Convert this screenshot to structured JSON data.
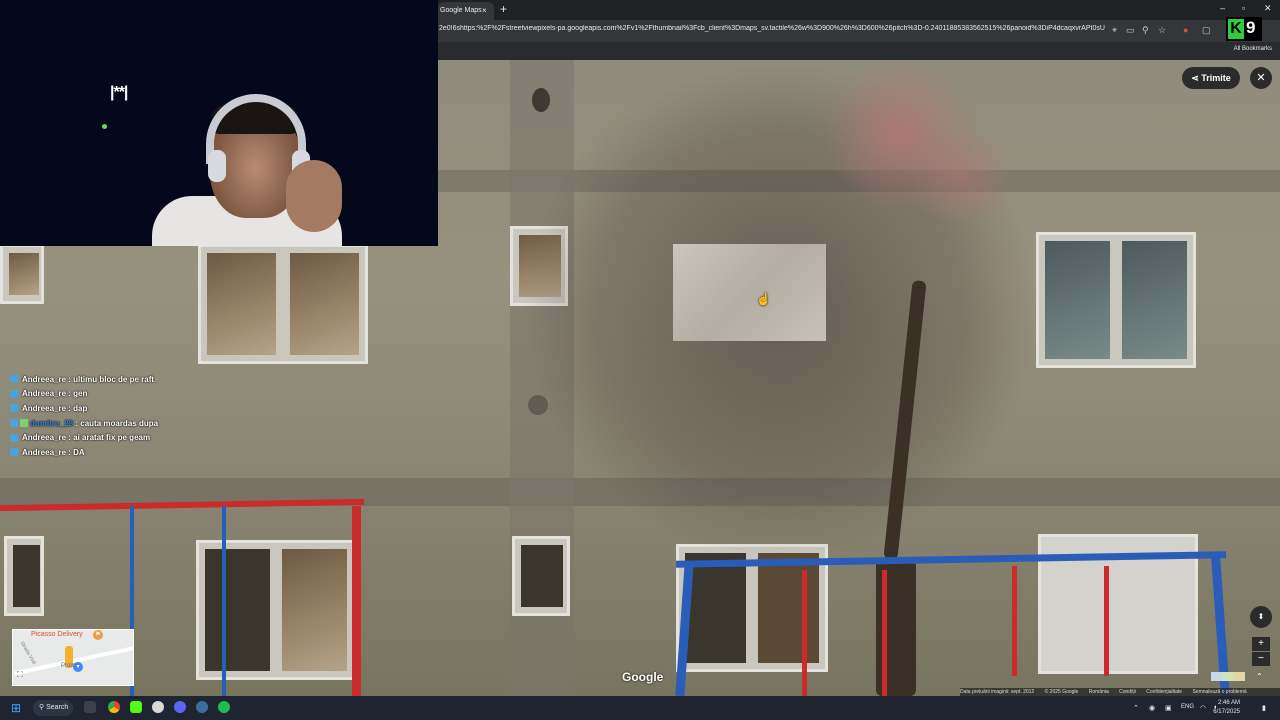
{
  "browser": {
    "tab_title": "Google Maps",
    "tab_close": "×",
    "new_tab": "+",
    "url": "2e0!6shttps:%2F%2Fstreetviewpixels-pa.googleapis.com%2Fv1%2Fthumbnail%3Fcb_client%3Dmaps_sv.tactile%26w%3D900%26h%3D600%26pitch%3D-0.24011885383562515%26panoid%3DiP4dcaqxvrAPt0sU-KE...",
    "all_bookmarks": "All Bookmarks",
    "window_minimize": "–",
    "window_maximize": "▫",
    "window_close": "✕"
  },
  "overlay": {
    "k9_letter": "K",
    "k9_number": "9",
    "webcam_logo": "|**|"
  },
  "chat": {
    "messages": [
      {
        "user": "Andreea_re",
        "text": ": ultimu bloc de pe raft"
      },
      {
        "user": "Andreea_re",
        "text": ": gen"
      },
      {
        "user": "Andreea_re",
        "text": ": dap"
      },
      {
        "user": "dumitru_28",
        "text": ": cauta moardas dupa"
      },
      {
        "user": "Andreea_re",
        "text": ": ai aratat fix pe geam"
      },
      {
        "user": "Andreea_re",
        "text": ": DA"
      }
    ]
  },
  "maps": {
    "share_label": "Trimite",
    "close_label": "✕",
    "watermark": "Google",
    "minimap_place": "Picasso Delivery",
    "minimap_street": "Strada Vinli",
    "minimap_blue": "Prom",
    "compass": "⬍",
    "zoom_in": "+",
    "zoom_out": "−",
    "expand": "⌃",
    "attribution": [
      "Data preluării imaginii: sept. 2012",
      "© 2025 Google",
      "România",
      "Condiții",
      "Confidențialitate",
      "Semnalează o problemă"
    ]
  },
  "taskbar": {
    "search_label": "Search",
    "lang": "ENG",
    "time": "2:46 AM",
    "date": "6/17/2025"
  }
}
